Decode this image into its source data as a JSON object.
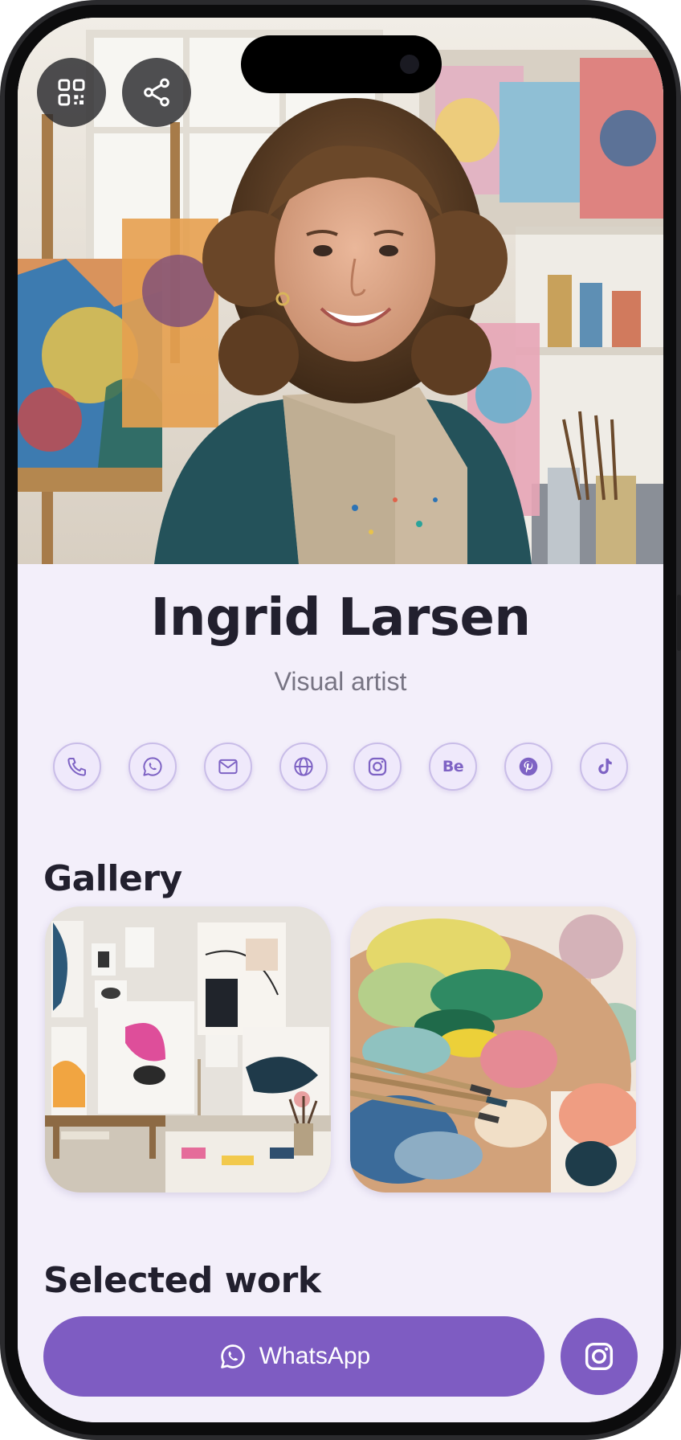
{
  "profile": {
    "name": "Ingrid Larsen",
    "title": "Visual artist"
  },
  "header_actions": [
    {
      "icon": "qr-code-icon"
    },
    {
      "icon": "share-icon"
    }
  ],
  "contact_icons": [
    {
      "icon": "phone-icon"
    },
    {
      "icon": "whatsapp-icon"
    },
    {
      "icon": "mail-icon"
    },
    {
      "icon": "globe-icon"
    },
    {
      "icon": "instagram-icon"
    },
    {
      "icon": "behance-icon",
      "text": "Be"
    },
    {
      "icon": "pinterest-icon"
    },
    {
      "icon": "tiktok-icon"
    }
  ],
  "sections": {
    "gallery": "Gallery",
    "selected_work": "Selected work"
  },
  "cta": {
    "whatsapp_label": "WhatsApp"
  },
  "colors": {
    "accent": "#7e5cc2",
    "background": "#f3effa",
    "text": "#22202e"
  }
}
